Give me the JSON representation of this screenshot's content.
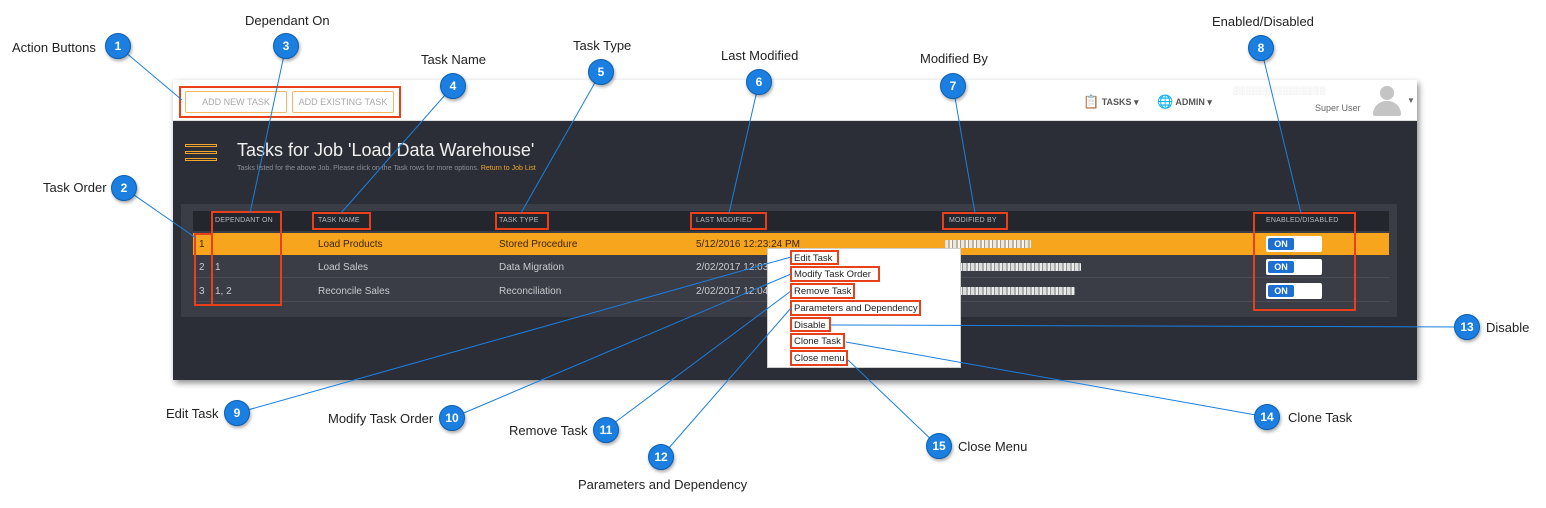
{
  "toolbar": {
    "add_new_task": "ADD NEW TASK",
    "add_existing_task": "ADD EXISTING TASK"
  },
  "nav": {
    "tasks_label": "TASKS",
    "tasks_icon": "clipboard-icon",
    "admin_label": "ADMIN",
    "admin_icon": "globe-icon"
  },
  "user": {
    "role": "Super User"
  },
  "page": {
    "title": "Tasks for Job 'Load Data Warehouse'",
    "subtitle": "Tasks listed for the above Job. Please click on the Task rows for more options.",
    "return_link": "Return to Job List"
  },
  "table": {
    "columns": {
      "dependant_on": "DEPENDANT ON",
      "task_name": "TASK NAME",
      "task_type": "TASK TYPE",
      "last_modified": "LAST MODIFIED",
      "modified_by": "MODIFIED BY",
      "enabled": "ENABLED/DISABLED"
    },
    "rows": [
      {
        "order": "1",
        "dependant_on": "",
        "task_name": "Load Products",
        "task_type": "Stored Procedure",
        "last_modified": "5/12/2016 12:23:24 PM",
        "enabled": "ON"
      },
      {
        "order": "2",
        "dependant_on": "1",
        "task_name": "Load Sales",
        "task_type": "Data Migration",
        "last_modified": "2/02/2017 12:03:",
        "enabled": "ON"
      },
      {
        "order": "3",
        "dependant_on": "1, 2",
        "task_name": "Reconcile Sales",
        "task_type": "Reconciliation",
        "last_modified": "2/02/2017 12:04:",
        "enabled": "ON"
      }
    ]
  },
  "context_menu": [
    "Edit Task",
    "Modify Task Order",
    "Remove Task",
    "Parameters and Dependency",
    "Disable",
    "Clone Task",
    "Close menu"
  ],
  "callouts": [
    {
      "num": "1",
      "label": "Action Buttons"
    },
    {
      "num": "2",
      "label": "Task Order"
    },
    {
      "num": "3",
      "label": "Dependant On"
    },
    {
      "num": "4",
      "label": "Task Name"
    },
    {
      "num": "5",
      "label": "Task Type"
    },
    {
      "num": "6",
      "label": "Last Modified"
    },
    {
      "num": "7",
      "label": "Modified By"
    },
    {
      "num": "8",
      "label": "Enabled/Disabled"
    },
    {
      "num": "9",
      "label": "Edit Task"
    },
    {
      "num": "10",
      "label": "Modify Task Order"
    },
    {
      "num": "11",
      "label": "Remove Task"
    },
    {
      "num": "12",
      "label": "Parameters and Dependency"
    },
    {
      "num": "13",
      "label": "Disable"
    },
    {
      "num": "14",
      "label": "Clone Task"
    },
    {
      "num": "15",
      "label": "Close Menu"
    }
  ],
  "colors": {
    "accent": "#f7a51d",
    "badge": "#1a7fe0",
    "highlight": "#e8401a",
    "toggle_on": "#1d6fd1",
    "dark_bg": "#2b2e36"
  }
}
